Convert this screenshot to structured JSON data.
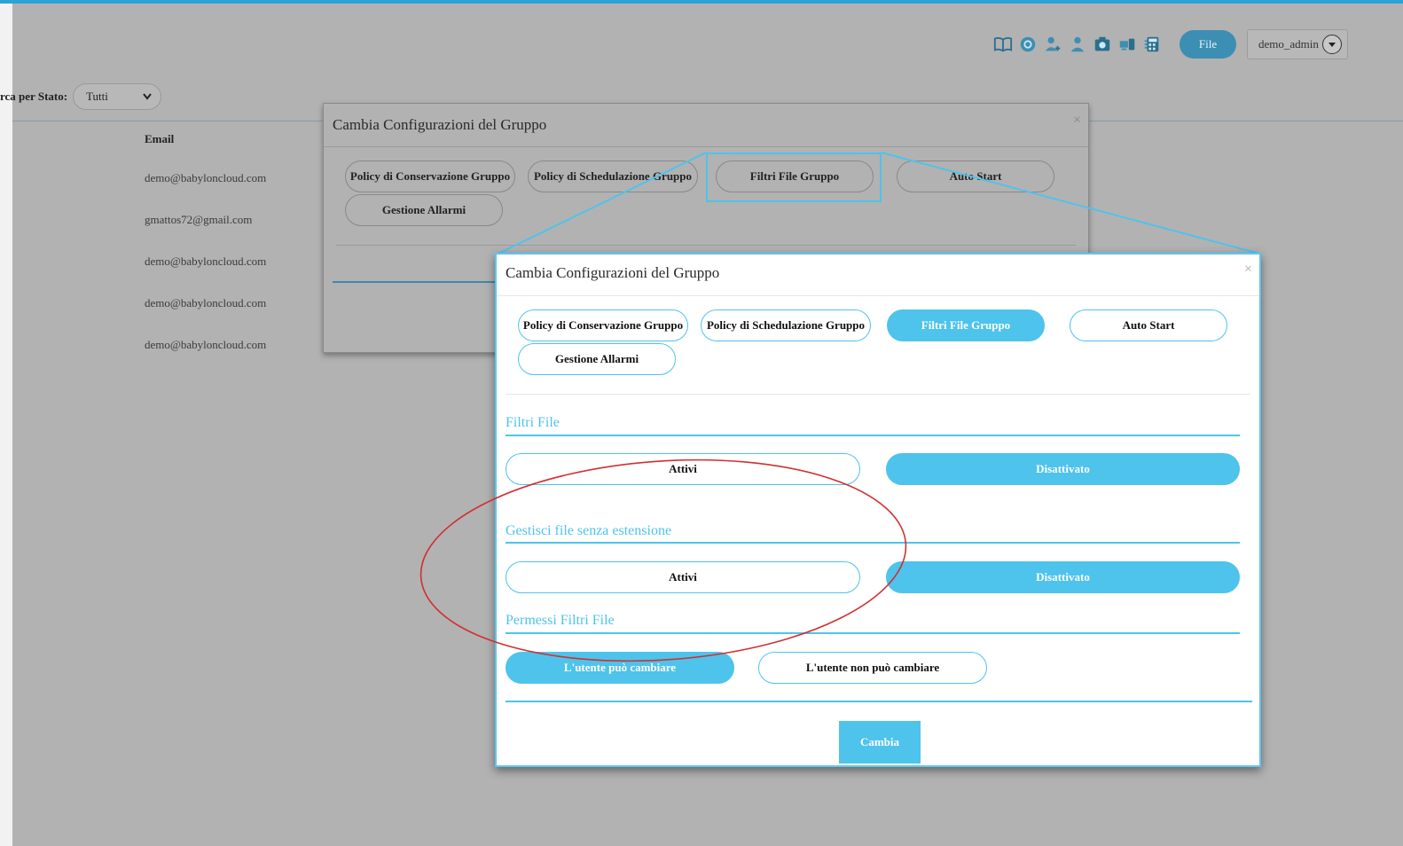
{
  "header": {
    "file_button": "File",
    "user": "demo_admin",
    "icons": [
      "book-icon",
      "settings-circle-icon",
      "user-add-icon",
      "user-icon",
      "camera-icon",
      "devices-icon",
      "calculator-icon"
    ]
  },
  "filter": {
    "label": "rca per Stato:",
    "value": "Tutti"
  },
  "table": {
    "email_header": "Email",
    "emails": [
      "demo@babyloncloud.com",
      "gmattos72@gmail.com",
      "demo@babyloncloud.com",
      "demo@babyloncloud.com",
      "demo@babyloncloud.com"
    ]
  },
  "dialog_back": {
    "title": "Cambia Configurazioni del Gruppo",
    "close": "×",
    "tabs": [
      "Policy di Conservazione Gruppo",
      "Policy di Schedulazione Gruppo",
      "Filtri File Gruppo",
      "Auto Start",
      "Gestione Allarmi"
    ]
  },
  "dialog": {
    "title": "Cambia Configurazioni del Gruppo",
    "close": "×",
    "tabs": [
      "Policy di Conservazione Gruppo",
      "Policy di Schedulazione Gruppo",
      "Filtri File Gruppo",
      "Auto Start",
      "Gestione Allarmi"
    ],
    "active_tab": "Filtri File Gruppo",
    "sections": [
      {
        "title": "Filtri File",
        "options": [
          "Attivi",
          "Disattivato"
        ],
        "selected": "Disattivato"
      },
      {
        "title": "Gestisci file senza estensione",
        "options": [
          "Attivi",
          "Disattivato"
        ],
        "selected": "Disattivato"
      },
      {
        "title": "Permessi Filtri File",
        "options": [
          "L'utente può cambiare",
          "L'utente non può cambiare"
        ],
        "selected": "L'utente può cambiare"
      }
    ],
    "submit": "Cambia"
  },
  "colors": {
    "accent": "#4ec3ec",
    "overlay_bg": "#b2b2b2",
    "annotation": "#d32f2f"
  }
}
